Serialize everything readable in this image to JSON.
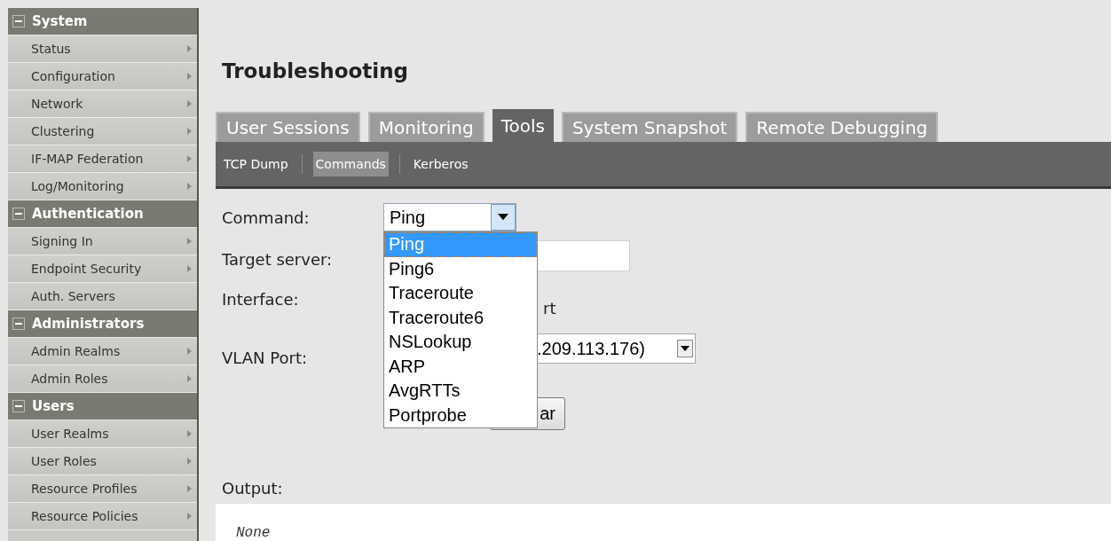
{
  "sidebar": {
    "sections": [
      {
        "title": "System",
        "expanded": true,
        "items": [
          {
            "label": "Status",
            "submenu": true
          },
          {
            "label": "Configuration",
            "submenu": true
          },
          {
            "label": "Network",
            "submenu": true
          },
          {
            "label": "Clustering",
            "submenu": true
          },
          {
            "label": "IF-MAP Federation",
            "submenu": true
          },
          {
            "label": "Log/Monitoring",
            "submenu": true
          }
        ]
      },
      {
        "title": "Authentication",
        "expanded": true,
        "items": [
          {
            "label": "Signing In",
            "submenu": true
          },
          {
            "label": "Endpoint Security",
            "submenu": true
          },
          {
            "label": "Auth. Servers",
            "submenu": false
          }
        ]
      },
      {
        "title": "Administrators",
        "expanded": true,
        "items": [
          {
            "label": "Admin Realms",
            "submenu": true
          },
          {
            "label": "Admin Roles",
            "submenu": true
          }
        ]
      },
      {
        "title": "Users",
        "expanded": true,
        "items": [
          {
            "label": "User Realms",
            "submenu": true
          },
          {
            "label": "User Roles",
            "submenu": true
          },
          {
            "label": "Resource Profiles",
            "submenu": true
          },
          {
            "label": "Resource Policies",
            "submenu": true
          }
        ]
      }
    ]
  },
  "page_title": "Troubleshooting",
  "tabs": [
    {
      "label": "User Sessions",
      "selected": false
    },
    {
      "label": "Monitoring",
      "selected": false
    },
    {
      "label": "Tools",
      "selected": true
    },
    {
      "label": "System Snapshot",
      "selected": false
    },
    {
      "label": "Remote Debugging",
      "selected": false
    }
  ],
  "subtabs": [
    {
      "label": "TCP Dump",
      "selected": false
    },
    {
      "label": "Commands",
      "selected": true
    },
    {
      "label": "Kerberos",
      "selected": false
    }
  ],
  "form": {
    "command": {
      "label": "Command:",
      "value": "Ping",
      "open": true,
      "options": [
        {
          "label": "Ping",
          "selected": true
        },
        {
          "label": "Ping6",
          "selected": false
        },
        {
          "label": "Traceroute",
          "selected": false
        },
        {
          "label": "Traceroute6",
          "selected": false
        },
        {
          "label": "NSLookup",
          "selected": false
        },
        {
          "label": "ARP",
          "selected": false
        },
        {
          "label": "AvgRTTs",
          "selected": false
        },
        {
          "label": "Portprobe",
          "selected": false
        }
      ]
    },
    "target_server": {
      "label": "Target server:"
    },
    "interface": {
      "label": "Interface:",
      "value": "rt"
    },
    "vlan_port": {
      "label": "VLAN Port:",
      "value": ".209.113.176)"
    },
    "button": {
      "label": "ar"
    }
  },
  "output": {
    "label": "Output:",
    "value": "None"
  }
}
